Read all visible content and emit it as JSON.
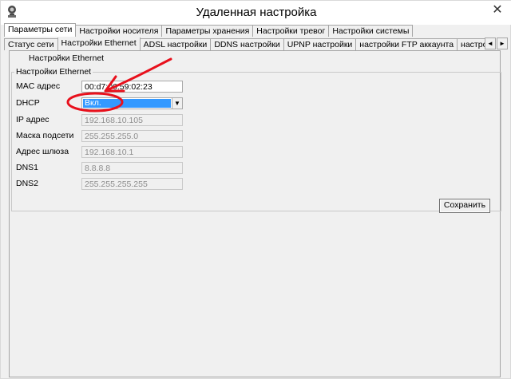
{
  "window": {
    "title": "Удаленная настройка",
    "close_glyph": "✕"
  },
  "tabs_row1": [
    {
      "label": "Параметры сети",
      "active": true
    },
    {
      "label": "Настройки носителя",
      "active": false
    },
    {
      "label": "Параметры хранения",
      "active": false
    },
    {
      "label": "Настройки тревог",
      "active": false
    },
    {
      "label": "Настройки системы",
      "active": false
    }
  ],
  "tabs_row2": [
    {
      "label": "Статус сети",
      "active": false
    },
    {
      "label": "Настройки Ethernet",
      "active": true
    },
    {
      "label": "ADSL настройки",
      "active": false
    },
    {
      "label": "DDNS настройки",
      "active": false
    },
    {
      "label": "UPNP настройки",
      "active": false
    },
    {
      "label": "настройки FTP аккаунта",
      "active": false
    },
    {
      "label": "настройки SMTP аккаунта",
      "active": false
    }
  ],
  "tab_scroll": {
    "left": "◄",
    "right": "►"
  },
  "panel": {
    "heading": "Настройки Ethernet",
    "group_title": "Настройки Ethernet"
  },
  "fields": {
    "mac": {
      "label": "MAC адрес",
      "value": "00:d7:06:59:02:23"
    },
    "dhcp": {
      "label": "DHCP",
      "value": "Вкл.",
      "arrow": "▼"
    },
    "ip": {
      "label": "IP адрес",
      "value": "192.168.10.105"
    },
    "mask": {
      "label": "Маска подсети",
      "value": "255.255.255.0"
    },
    "gateway": {
      "label": "Адрес шлюза",
      "value": "192.168.10.1"
    },
    "dns1": {
      "label": "DNS1",
      "value": "8.8.8.8"
    },
    "dns2": {
      "label": "DNS2",
      "value": "255.255.255.255"
    }
  },
  "buttons": {
    "save": "Сохранить"
  },
  "annotation_color": "#e8101c"
}
